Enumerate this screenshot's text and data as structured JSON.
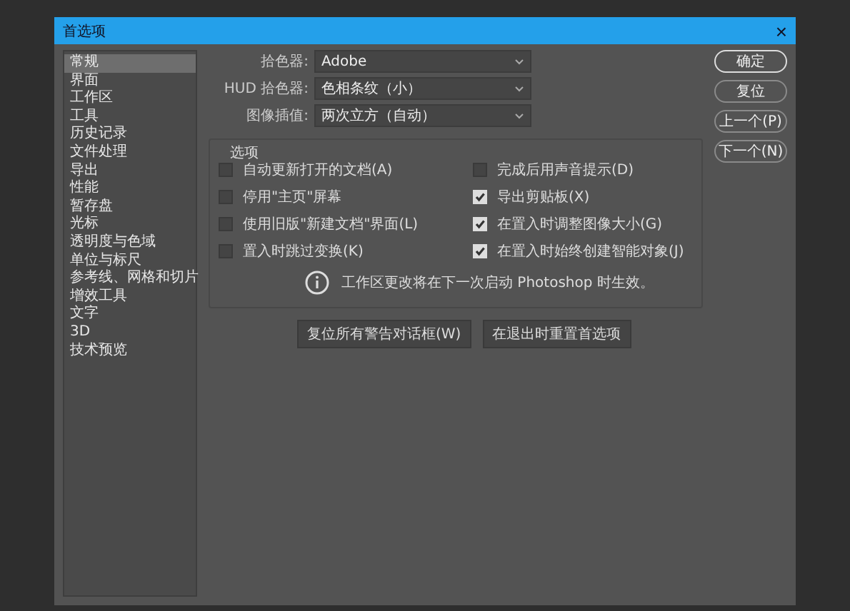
{
  "window": {
    "title": "首选项",
    "close": "×"
  },
  "sidebar": {
    "items": [
      {
        "label": "常规",
        "selected": true
      },
      {
        "label": "界面",
        "selected": false
      },
      {
        "label": "工作区",
        "selected": false
      },
      {
        "label": "工具",
        "selected": false
      },
      {
        "label": "历史记录",
        "selected": false
      },
      {
        "label": "文件处理",
        "selected": false
      },
      {
        "label": "导出",
        "selected": false
      },
      {
        "label": "性能",
        "selected": false
      },
      {
        "label": "暂存盘",
        "selected": false
      },
      {
        "label": "光标",
        "selected": false
      },
      {
        "label": "透明度与色域",
        "selected": false
      },
      {
        "label": "单位与标尺",
        "selected": false
      },
      {
        "label": "参考线、网格和切片",
        "selected": false
      },
      {
        "label": "增效工具",
        "selected": false
      },
      {
        "label": "文字",
        "selected": false
      },
      {
        "label": "3D",
        "selected": false
      },
      {
        "label": "技术预览",
        "selected": false
      }
    ]
  },
  "fields": [
    {
      "label": "拾色器:",
      "value": "Adobe"
    },
    {
      "label": "HUD 拾色器:",
      "value": "色相条纹（小）"
    },
    {
      "label": "图像插值:",
      "value": "两次立方（自动）"
    }
  ],
  "options": {
    "title": "选项",
    "items": [
      {
        "label": "自动更新打开的文档(A)",
        "checked": false
      },
      {
        "label": "完成后用声音提示(D)",
        "checked": false
      },
      {
        "label": "停用\"主页\"屏幕",
        "checked": false
      },
      {
        "label": "导出剪贴板(X)",
        "checked": true
      },
      {
        "label": "使用旧版\"新建文档\"界面(L)",
        "checked": false
      },
      {
        "label": "在置入时调整图像大小(G)",
        "checked": true
      },
      {
        "label": "置入时跳过变换(K)",
        "checked": false
      },
      {
        "label": "在置入时始终创建智能对象(J)",
        "checked": true
      }
    ],
    "notice": "工作区更改将在下一次启动 Photoshop 时生效。"
  },
  "actions": [
    "复位所有警告对话框(W)",
    "在退出时重置首选项"
  ],
  "buttons": [
    {
      "label": "确定",
      "default": true
    },
    {
      "label": "复位",
      "default": false
    },
    {
      "label": "上一个(P)",
      "default": false
    },
    {
      "label": "下一个(N)",
      "default": false
    }
  ]
}
